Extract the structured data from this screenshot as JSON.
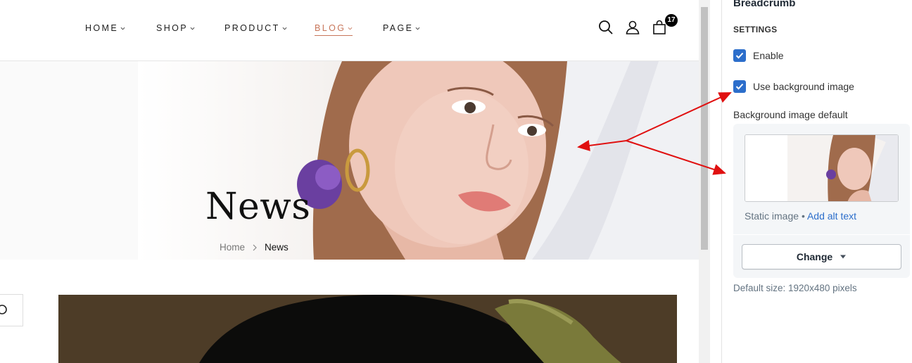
{
  "nav": {
    "items": [
      {
        "label": "HOME"
      },
      {
        "label": "SHOP"
      },
      {
        "label": "PRODUCT"
      },
      {
        "label": "BLOG"
      },
      {
        "label": "PAGE"
      }
    ],
    "active": "BLOG",
    "accent_color": "#c8765a",
    "icons": [
      "search-icon",
      "user-icon",
      "cart-icon"
    ],
    "cart_count": "17"
  },
  "hero": {
    "title": "News",
    "breadcrumb": {
      "home": "Home",
      "separator": ">",
      "current": "News"
    }
  },
  "panel": {
    "title": "Breadcrumb",
    "section_label": "SETTINGS",
    "enable_label": "Enable",
    "enable_checked": true,
    "use_bg_label": "Use background image",
    "use_bg_checked": true,
    "bg_default_label": "Background image default",
    "image_type": "Static image",
    "meta_separator": "•",
    "alt_link": "Add alt text",
    "change_label": "Change",
    "default_size": "Default size: 1920x480 pixels",
    "accent_color": "#2c6ecb"
  },
  "annotation": {
    "arrow_color": "#e01010"
  }
}
